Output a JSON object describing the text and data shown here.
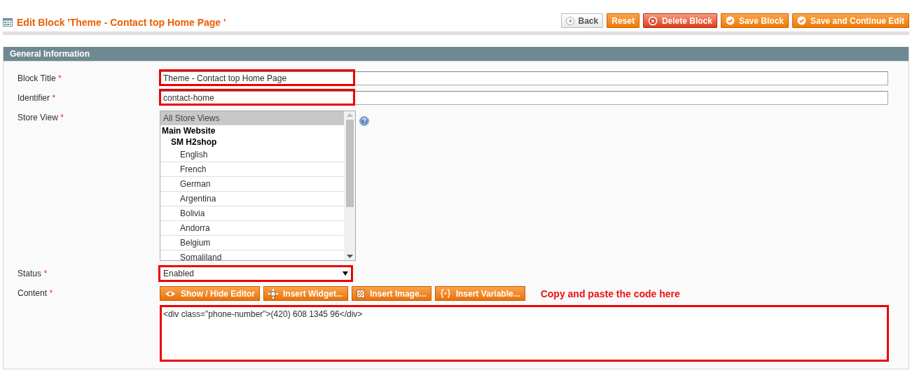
{
  "header": {
    "title": "Edit Block 'Theme - Contact top Home Page '"
  },
  "buttons": [
    {
      "label": "Back",
      "kind": "back"
    },
    {
      "label": "Reset",
      "kind": "reset"
    },
    {
      "label": "Delete Block",
      "kind": "delete"
    },
    {
      "label": "Save Block",
      "kind": "save"
    },
    {
      "label": "Save and Continue Edit",
      "kind": "save"
    }
  ],
  "panel": {
    "title": "General Information"
  },
  "fields": [
    {
      "kind": "text",
      "label": "Block Title",
      "required_mark": "*",
      "value": "Theme - Contact top Home Page",
      "highlighted": true
    },
    {
      "kind": "text",
      "label": "Identifier",
      "required_mark": "*",
      "value": "contact-home",
      "highlighted": true
    },
    {
      "kind": "multiselect",
      "label": "Store View",
      "required_mark": "*",
      "options": [
        {
          "kind": "all",
          "label": "All Store Views",
          "selected": true
        },
        {
          "kind": "website",
          "label": "Main Website",
          "selected": false,
          "children": [
            {
              "kind": "store",
              "label": "SM H2shop",
              "selected": false,
              "children": [
                {
                  "kind": "view",
                  "label": "English",
                  "selected": false
                },
                {
                  "kind": "view",
                  "label": "French",
                  "selected": false
                },
                {
                  "kind": "view",
                  "label": "German",
                  "selected": false
                },
                {
                  "kind": "view",
                  "label": "Argentina",
                  "selected": false
                },
                {
                  "kind": "view",
                  "label": "Bolivia",
                  "selected": false
                },
                {
                  "kind": "view",
                  "label": "Andorra",
                  "selected": false
                },
                {
                  "kind": "view",
                  "label": "Belgium",
                  "selected": false
                },
                {
                  "kind": "view",
                  "label": "Somaliland",
                  "selected": false
                }
              ]
            }
          ]
        }
      ]
    },
    {
      "kind": "select",
      "label": "Status",
      "required_mark": "*",
      "value": "Enabled",
      "highlighted": true
    },
    {
      "kind": "editor",
      "label": "Content",
      "required_mark": "*",
      "highlighted": true,
      "tools": [
        {
          "label": "Show / Hide Editor",
          "kind": "eye"
        },
        {
          "label": "Insert Widget...",
          "kind": "widget"
        },
        {
          "label": "Insert Image...",
          "kind": "image"
        },
        {
          "label": "Insert Variable...",
          "kind": "variable"
        }
      ],
      "note": "Copy and paste the code here",
      "value": "<div class=\"phone-number\">(420) 608 1345 96</div>"
    }
  ]
}
